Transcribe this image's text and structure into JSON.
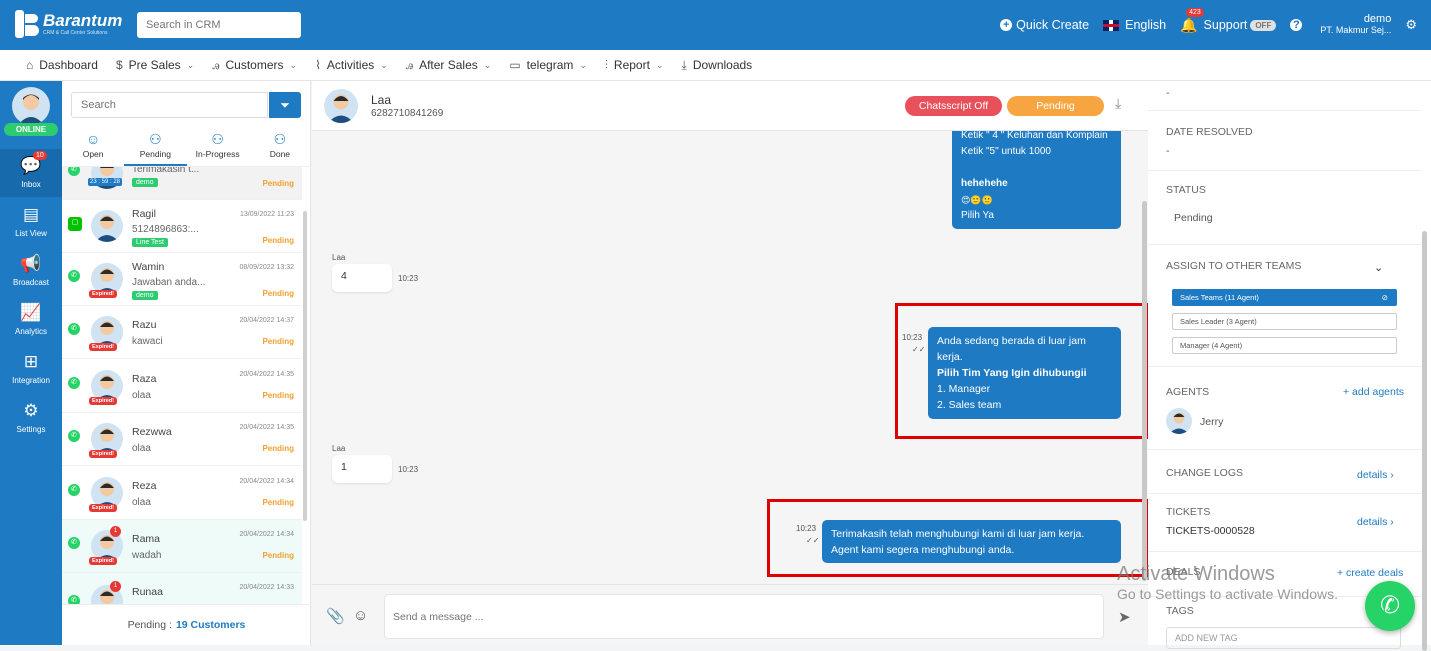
{
  "topbar": {
    "brand": "Barantum",
    "brand_sub": "CRM & Call Center Solutions",
    "search_placeholder": "Search in CRM",
    "quick_create": "Quick Create",
    "language": "English",
    "notif_count": "423",
    "support": "Support",
    "support_toggle": "OFF",
    "user_name": "demo",
    "user_company": "PT. Makmur Sej...",
    "brand_color": "#1e7ac3"
  },
  "nav": {
    "items": [
      {
        "label": "Dashboard",
        "icon": "home-icon"
      },
      {
        "label": "Pre Sales",
        "icon": "dollar-icon"
      },
      {
        "label": "Customers",
        "icon": "users-icon"
      },
      {
        "label": "Activities",
        "icon": "activity-icon"
      },
      {
        "label": "After Sales",
        "icon": "users-icon"
      },
      {
        "label": "telegram",
        "icon": "window-icon"
      },
      {
        "label": "Report",
        "icon": "bar-chart-icon"
      },
      {
        "label": "Downloads",
        "icon": "download-icon"
      }
    ]
  },
  "sidebar": {
    "status": "ONLINE",
    "items": [
      {
        "label": "Inbox",
        "icon": "chat-icon",
        "badge": "10"
      },
      {
        "label": "List View",
        "icon": "list-icon"
      },
      {
        "label": "Broadcast",
        "icon": "megaphone-icon"
      },
      {
        "label": "Analytics",
        "icon": "line-chart-icon"
      },
      {
        "label": "Integration",
        "icon": "grid-icon"
      },
      {
        "label": "Settings",
        "icon": "gear-icon"
      }
    ]
  },
  "list": {
    "search_placeholder": "Search",
    "tabs": [
      {
        "label": "Open"
      },
      {
        "label": "Pending"
      },
      {
        "label": "In-Progress"
      },
      {
        "label": "Done"
      }
    ],
    "chats": [
      {
        "name": "",
        "date": "",
        "message": "Terimakasih t...",
        "status": "Pending",
        "tag": "demo",
        "timer": "23 : 59 : 28",
        "channel": "whatsapp"
      },
      {
        "name": "Ragil",
        "date": "13/09/2022 11:23",
        "message": "5124896863:...",
        "status": "Pending",
        "tag": "Line Test",
        "channel": "line"
      },
      {
        "name": "Wamin",
        "date": "08/09/2022 13:32",
        "message": "Jawaban anda...",
        "status": "Pending",
        "tag": "demo",
        "expired": "Expired!",
        "channel": "whatsapp"
      },
      {
        "name": "Razu",
        "date": "20/04/2022 14:37",
        "message": "kawaci",
        "status": "Pending",
        "expired": "Expired!",
        "channel": "whatsapp"
      },
      {
        "name": "Raza",
        "date": "20/04/2022 14:35",
        "message": "olaa",
        "status": "Pending",
        "expired": "Expired!",
        "channel": "whatsapp"
      },
      {
        "name": "Rezwwa",
        "date": "20/04/2022 14:35",
        "message": "olaa",
        "status": "Pending",
        "expired": "Expired!",
        "channel": "whatsapp"
      },
      {
        "name": "Reza",
        "date": "20/04/2022 14:34",
        "message": "olaa",
        "status": "Pending",
        "expired": "Expired!",
        "channel": "whatsapp"
      },
      {
        "name": "Rama",
        "date": "20/04/2022 14:34",
        "message": "wadah",
        "status": "Pending",
        "expired": "Expired!",
        "count": "1",
        "channel": "whatsapp"
      },
      {
        "name": "Runaa",
        "date": "20/04/2022 14:33",
        "message": "",
        "status": "",
        "count": "1",
        "channel": "whatsapp"
      }
    ],
    "footer_label": "Pending :",
    "footer_count": "19 Customers"
  },
  "chat": {
    "contact_name": "Laa",
    "contact_phone": "6282710841269",
    "chatscript_label": "Chatsscript Off",
    "status_label": "Pending",
    "top_bubble_lines": [
      "Ketik \" 4 \" Keluhan dan Komplain",
      "Ketik \"5\" untuk 1000",
      "",
      "hehehehe",
      "😍🙂🙂",
      "Pilih Ya"
    ],
    "messages": [
      {
        "direction": "in",
        "sender": "Laa",
        "text": "4",
        "time": "10:23"
      },
      {
        "direction": "out",
        "time": "10:23",
        "lines": [
          "Anda sedang berada di luar jam kerja.",
          "Pilih Tim Yang Igin dihubungii",
          "1. Manager",
          "2. Sales team"
        ]
      },
      {
        "direction": "in",
        "sender": "Laa",
        "text": "1",
        "time": "10:23"
      },
      {
        "direction": "out",
        "time": "10:23",
        "lines": [
          "Terimakasih telah menghubungi kami di luar jam kerja.",
          "Agent kami segera menghubungi anda."
        ]
      }
    ],
    "composer_placeholder": "Send a message ..."
  },
  "detail": {
    "top_value": "-",
    "date_resolved_label": "DATE RESOLVED",
    "date_resolved_value": "-",
    "status_label": "STATUS",
    "status_value": "Pending",
    "assign_label": "ASSIGN TO OTHER TEAMS",
    "teams": [
      "Sales Teams (11 Agent)",
      "Sales Leader (3 Agent)",
      "Manager (4 Agent)"
    ],
    "agents_label": "AGENTS",
    "add_agents": "+ add agents",
    "agent_name": "Jerry",
    "change_logs_label": "CHANGE LOGS",
    "details_link": "details",
    "tickets_label": "TICKETS",
    "ticket_value": "TICKETS-0000528",
    "deals_label": "DEALS",
    "create_deals": "+ create deals",
    "tags_label": "TAGS",
    "add_tag": "ADD NEW TAG"
  },
  "watermark": {
    "line1": "Activate Windows",
    "line2": "Go to Settings to activate Windows."
  }
}
